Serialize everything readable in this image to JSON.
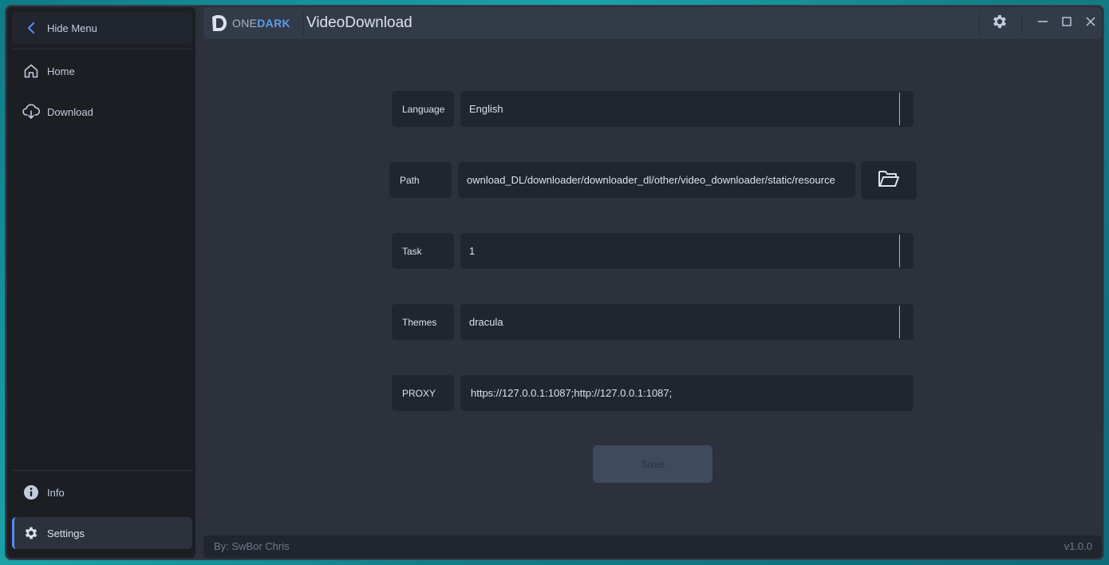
{
  "app": {
    "title": "VideoDownload",
    "logo_one": "ONE",
    "logo_dark": "DARK"
  },
  "sidebar": {
    "toggle_label": "Hide Menu",
    "items": [
      {
        "label": "Home",
        "icon": "home-icon"
      },
      {
        "label": "Download",
        "icon": "cloud-download-icon"
      }
    ],
    "bottom_items": [
      {
        "label": "Info",
        "icon": "info-icon"
      },
      {
        "label": "Settings",
        "icon": "gear-icon",
        "active": true
      }
    ]
  },
  "settings": {
    "language": {
      "label": "Language",
      "value": "English"
    },
    "path": {
      "label": "Path",
      "value": "ownload_DL/downloader/downloader_dl/other/video_downloader/static/resource"
    },
    "task": {
      "label": "Task",
      "value": "1"
    },
    "themes": {
      "label": "Themes",
      "value": "dracula"
    },
    "proxy": {
      "label": "PROXY",
      "value": "https://127.0.0.1:1087;http://127.0.0.1:1087;"
    },
    "save_label": "Save"
  },
  "status": {
    "credit": "By: SwBor Chris",
    "version": "v1.0.0"
  },
  "colors": {
    "accent": "#568af2",
    "bg": "#2c313c",
    "panel": "#21252d",
    "sidebar": "#1b1e23"
  }
}
